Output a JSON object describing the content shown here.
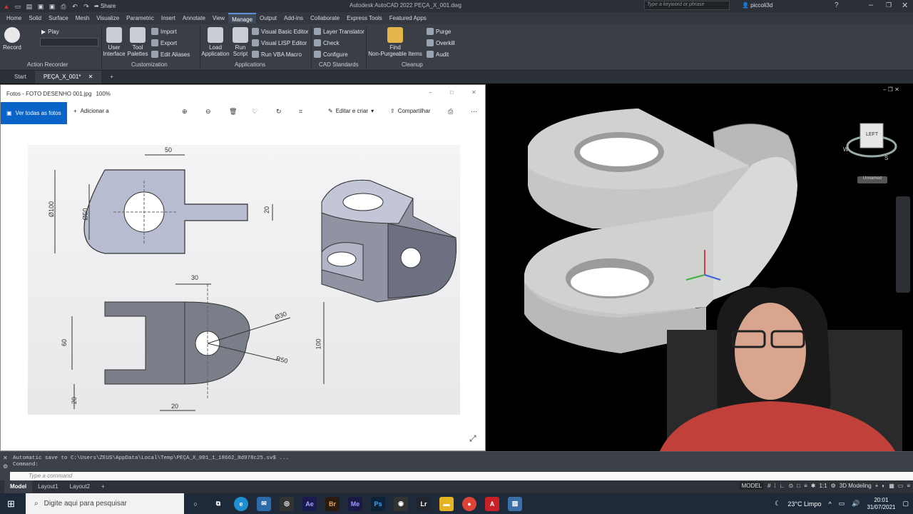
{
  "titlebar": {
    "title": "Autodesk AutoCAD 2022    PEÇA_X_001.dwg",
    "share_label": "Share",
    "search_placeholder": "Type a keyword or phrase",
    "user_name": "piccoli3d"
  },
  "ribbon_tabs": [
    "Home",
    "Solid",
    "Surface",
    "Mesh",
    "Visualize",
    "Parametric",
    "Insert",
    "Annotate",
    "View",
    "Manage",
    "Output",
    "Add-ins",
    "Collaborate",
    "Express Tools",
    "Featured Apps"
  ],
  "active_tab": "Manage",
  "ribbon": {
    "record": "Record",
    "play": "Play",
    "action_recorder": "Action Recorder",
    "user_interface": [
      "User",
      "Interface"
    ],
    "tool_palettes": [
      "Tool",
      "Palettes"
    ],
    "import": "Import",
    "export": "Export",
    "edit_aliases": "Edit Aliases",
    "customization": "Customization",
    "load_application": [
      "Load",
      "Application"
    ],
    "run_script": [
      "Run",
      "Script"
    ],
    "visual_basic_editor": "Visual Basic Editor",
    "visual_lisp_editor": "Visual LISP Editor",
    "run_vba_macro": "Run VBA Macro",
    "applications": "Applications",
    "layer_translator": "Layer Translator",
    "check": "Check",
    "configure": "Configure",
    "cad_standards": "CAD Standards",
    "find": "Find",
    "non_purgeable": "Non-Purgeable Items",
    "purge": "Purge",
    "overkill": "Overkill",
    "audit": "Audit",
    "cleanup": "Cleanup"
  },
  "doc_tabs": [
    "Start",
    "PEÇA_X_001*"
  ],
  "photos": {
    "title": "Fotos - FOTO DESENHO 001.jpg",
    "zoom": "100%",
    "ver_todas": "Ver todas as fotos",
    "adicionar": "Adicionar a",
    "editar": "Editar e criar",
    "compartilhar": "Compartilhar"
  },
  "drawing_dims": {
    "top_50": "50",
    "d100": "Ø100",
    "d50": "Ø50",
    "d20": "20",
    "bottom_30": "30",
    "d60": "60",
    "dia30": "Ø30",
    "r50": "R50",
    "d100b": "100",
    "d20b": "20",
    "d20c": "20"
  },
  "viewcube": {
    "face": "LEFT",
    "unnamed": "Unnamed",
    "w": "W",
    "s": "S"
  },
  "command": {
    "history1": "Automatic save to C:\\Users\\ZEUS\\AppData\\Local\\Temp\\PEÇA_X_001_1_18662_8d978c25.sv$ ...",
    "history2": "Command:",
    "placeholder": "Type a command"
  },
  "layout_tabs": [
    "Model",
    "Layout1",
    "Layout2"
  ],
  "status": {
    "model": "MODEL",
    "scale": "1:1",
    "workspace": "3D Modeling"
  },
  "taskbar": {
    "search": "Digite aqui para pesquisar",
    "weather": "23°C  Limpo",
    "time": "20:01",
    "date": "31/07/2021"
  },
  "colors": {
    "accent": "#0a64c8",
    "ribbon_bg": "#3a3f47"
  }
}
